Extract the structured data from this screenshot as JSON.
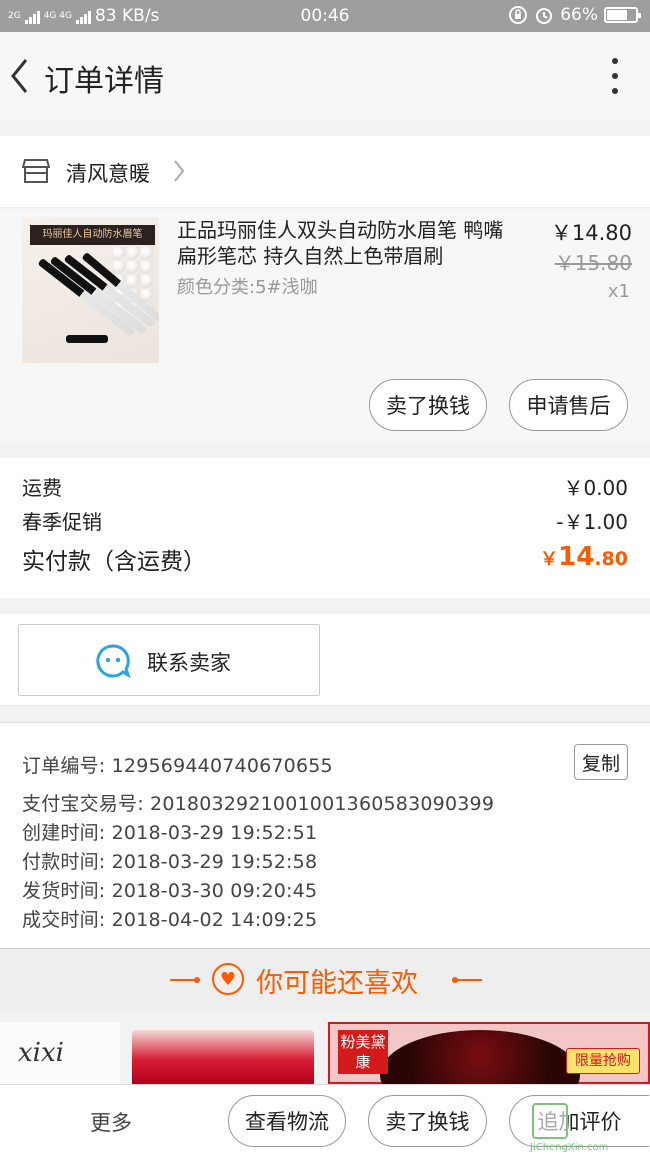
{
  "status_bar": {
    "sim1": "2G",
    "sim2": "4G 4G",
    "speed": "83 KB/s",
    "time": "00:46",
    "battery": "66%",
    "battery_level": 0.66
  },
  "header": {
    "title": "订单详情"
  },
  "shop": {
    "name": "清风意暖"
  },
  "item": {
    "image_banner": "玛丽佳人自动防水眉笔",
    "title": "正品玛丽佳人双头自动防水眉笔 鸭嘴扁形笔芯 持久自然上色带眉刷",
    "sku": "颜色分类:5#浅咖",
    "price": "￥14.80",
    "original_price": "￥15.80",
    "quantity": "x1",
    "btn_sell": "卖了换钱",
    "btn_after_sale": "申请售后"
  },
  "fees": {
    "shipping_label": "运费",
    "shipping_value": "￥0.00",
    "promo_label": "春季促销",
    "promo_value": "-￥1.00",
    "paid_label": "实付款（含运费）",
    "paid_yen": "￥",
    "paid_int": "14",
    "paid_dec": ".80"
  },
  "contact": {
    "label": "联系卖家"
  },
  "order_info": {
    "order_no": "订单编号: 129569440740670655",
    "alipay_no": "支付宝交易号: 2018032921001001360583090399",
    "created": "创建时间: 2018-03-29 19:52:51",
    "paid": "付款时间: 2018-03-29 19:52:58",
    "shipped": "发货时间: 2018-03-30 09:20:45",
    "closed": "成交时间: 2018-04-02 14:09:25",
    "copy_label": "复制"
  },
  "recommend": {
    "title": "你可能还喜欢",
    "card1_brand": "xixi",
    "card3_tag": "粉美黛康",
    "card3_promo": "限量抢购"
  },
  "bottom_bar": {
    "more": "更多",
    "btn_logistics": "查看物流",
    "btn_sell": "卖了换钱",
    "btn_review": "追加评价"
  },
  "watermark": {
    "text": "JiChengXin.com"
  },
  "colors": {
    "accent": "#ff5a00",
    "status_bar": "#9e9e9e",
    "contact_icon": "#2aa5e0"
  }
}
